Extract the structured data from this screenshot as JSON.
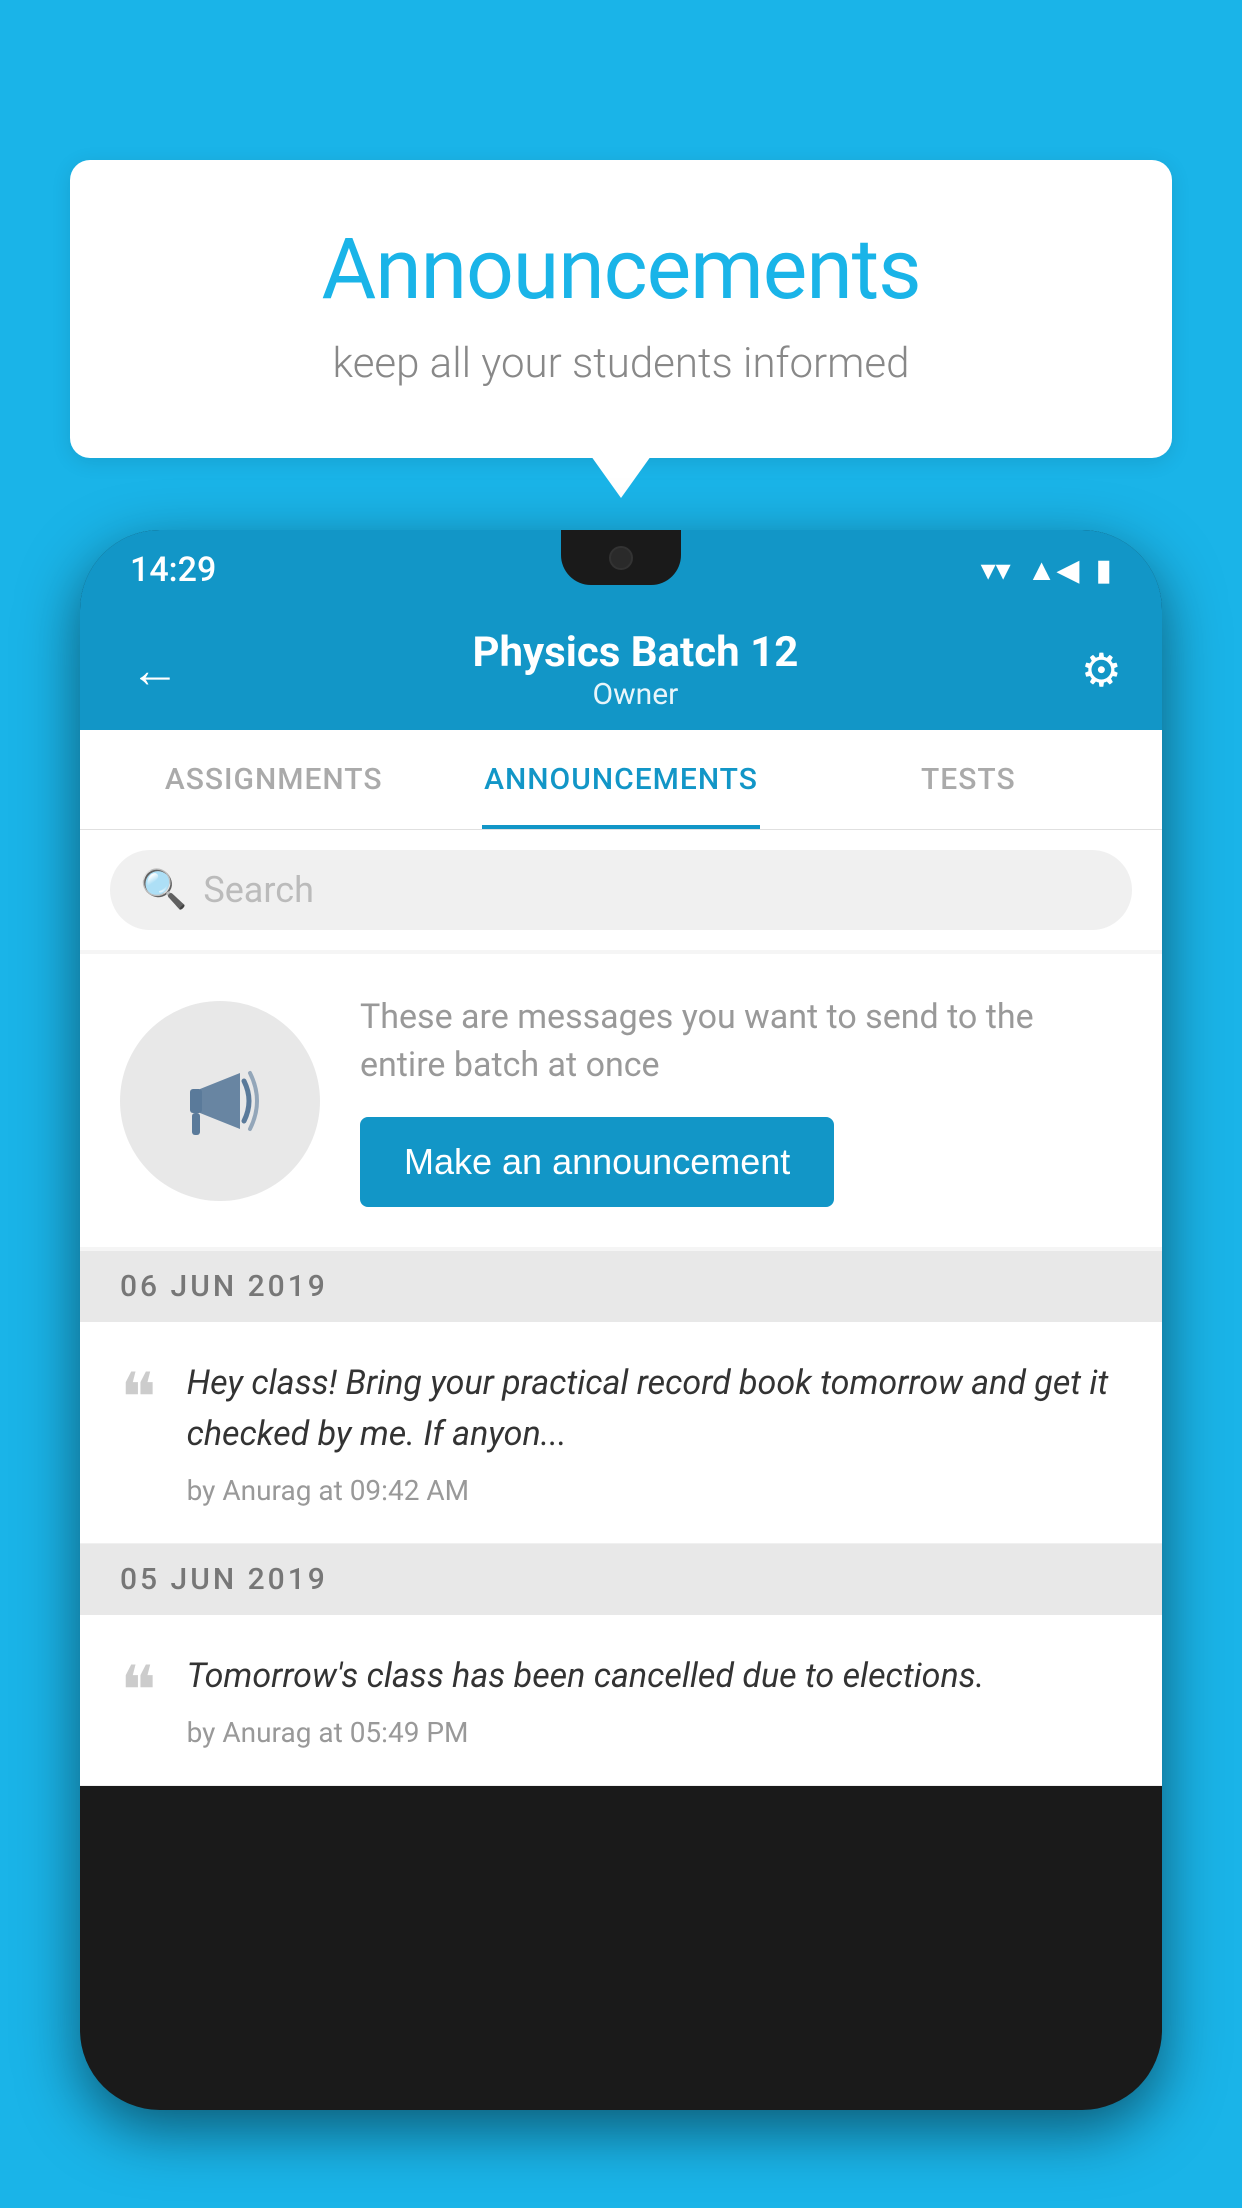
{
  "background_color": "#1ab4e8",
  "speech_bubble": {
    "title": "Announcements",
    "subtitle": "keep all your students informed"
  },
  "status_bar": {
    "time": "14:29",
    "wifi": "▼",
    "signal": "▲",
    "battery": "▮"
  },
  "app_bar": {
    "title": "Physics Batch 12",
    "subtitle": "Owner",
    "back_label": "←",
    "settings_label": "⚙"
  },
  "tabs": [
    {
      "label": "ASSIGNMENTS",
      "active": false
    },
    {
      "label": "ANNOUNCEMENTS",
      "active": true
    },
    {
      "label": "TESTS",
      "active": false
    }
  ],
  "search": {
    "placeholder": "Search"
  },
  "announcement_prompt": {
    "description": "These are messages you want to send to the entire batch at once",
    "cta_label": "Make an announcement"
  },
  "announcements": [
    {
      "date": "06  JUN  2019",
      "message": "Hey class! Bring your practical record book tomorrow and get it checked by me. If anyon...",
      "meta": "by Anurag at 09:42 AM"
    },
    {
      "date": "05  JUN  2019",
      "message": "Tomorrow's class has been cancelled due to elections.",
      "meta": "by Anurag at 05:49 PM"
    }
  ]
}
